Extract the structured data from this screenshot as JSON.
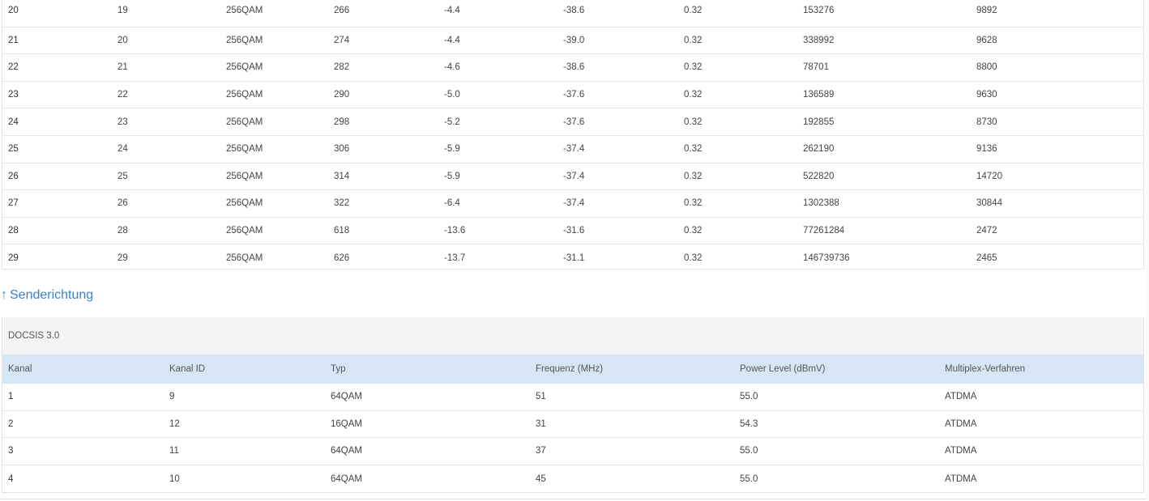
{
  "downstream": {
    "rows": [
      [
        "20",
        "19",
        "256QAM",
        "266",
        "-4.4",
        "-38.6",
        "0.32",
        "153276",
        "9892"
      ],
      [
        "21",
        "20",
        "256QAM",
        "274",
        "-4.4",
        "-39.0",
        "0.32",
        "338992",
        "9628"
      ],
      [
        "22",
        "21",
        "256QAM",
        "282",
        "-4.6",
        "-38.6",
        "0.32",
        "78701",
        "8800"
      ],
      [
        "23",
        "22",
        "256QAM",
        "290",
        "-5.0",
        "-37.6",
        "0.32",
        "136589",
        "9630"
      ],
      [
        "24",
        "23",
        "256QAM",
        "298",
        "-5.2",
        "-37.6",
        "0.32",
        "192855",
        "8730"
      ],
      [
        "25",
        "24",
        "256QAM",
        "306",
        "-5.9",
        "-37.4",
        "0.32",
        "262190",
        "9136"
      ],
      [
        "26",
        "25",
        "256QAM",
        "314",
        "-5.9",
        "-37.4",
        "0.32",
        "522820",
        "14720"
      ],
      [
        "27",
        "26",
        "256QAM",
        "322",
        "-6.4",
        "-37.4",
        "0.32",
        "1302388",
        "30844"
      ],
      [
        "28",
        "28",
        "256QAM",
        "618",
        "-13.6",
        "-31.6",
        "0.32",
        "77261284",
        "2472"
      ],
      [
        "29",
        "29",
        "256QAM",
        "626",
        "-13.7",
        "-31.1",
        "0.32",
        "146739736",
        "2465"
      ]
    ]
  },
  "upstream": {
    "heading": "Senderichtung",
    "arrow": "↑",
    "caption": "DOCSIS 3.0",
    "columns": [
      "Kanal",
      "Kanal ID",
      "Typ",
      "Frequenz (MHz)",
      "Power Level (dBmV)",
      "Multiplex-Verfahren"
    ],
    "rows": [
      [
        "1",
        "9",
        "64QAM",
        "51",
        "55.0",
        "ATDMA"
      ],
      [
        "2",
        "12",
        "16QAM",
        "31",
        "54.3",
        "ATDMA"
      ],
      [
        "3",
        "11",
        "64QAM",
        "37",
        "55.0",
        "ATDMA"
      ],
      [
        "4",
        "10",
        "64QAM",
        "45",
        "55.0",
        "ATDMA"
      ]
    ]
  },
  "colors": {
    "link": "#3b83c4",
    "header_bg": "#d6e6f4",
    "caption_bg": "#f5f5f3"
  }
}
